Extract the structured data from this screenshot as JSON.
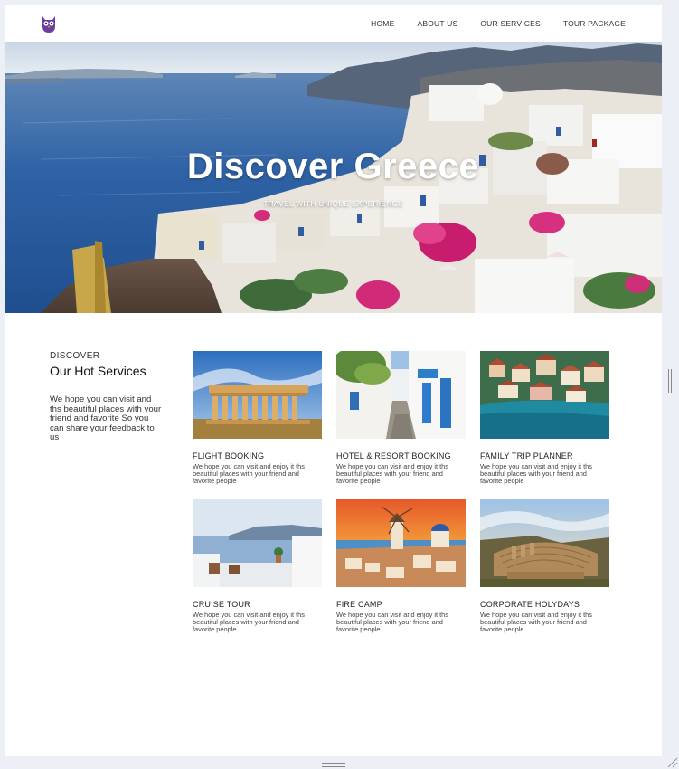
{
  "nav": {
    "logo_icon": "owl-logo-icon",
    "items": [
      {
        "label": "HOME"
      },
      {
        "label": "ABOUT US"
      },
      {
        "label": "OUR SERVICES"
      },
      {
        "label": "TOUR PACKAGE"
      }
    ]
  },
  "hero": {
    "title": "Discover Greece",
    "subtitle": "TRAVEL WITH UNIQUE EXPERIENCE"
  },
  "intro": {
    "kicker": "DISCOVER",
    "heading": "Our Hot Services",
    "text": "We hope you can visit and ths beautiful places with your friend and favorite So you can share your feedback to us"
  },
  "services": [
    {
      "title": "FLIGHT BOOKING",
      "text": "We hope you can visit and enjoy it ths beautiful places with your friend and favorite people",
      "image": "parthenon-photo"
    },
    {
      "title": "HOTEL & RESORT BOOKING",
      "text": "We hope you can visit and enjoy it ths beautiful places with your friend and favorite people",
      "image": "white-alley-photo"
    },
    {
      "title": "FAMILY TRIP PLANNER",
      "text": "We hope you can visit and enjoy it ths beautiful places with your friend and favorite people",
      "image": "coastal-village-photo"
    },
    {
      "title": "CRUISE TOUR",
      "text": "We hope you can visit and enjoy it ths beautiful places with your friend and favorite people",
      "image": "terrace-sea-view-photo"
    },
    {
      "title": "FIRE CAMP",
      "text": "We hope you can visit and enjoy it ths beautiful places with your friend and favorite people",
      "image": "windmills-sunset-photo"
    },
    {
      "title": "CORPORATE HOLYDAYS",
      "text": "We hope you can visit and enjoy it ths beautiful places with your friend and favorite people",
      "image": "ancient-theater-photo"
    }
  ],
  "colors": {
    "logo": "#6b3fa0",
    "sea": "#2a5fa8",
    "bougainvillea": "#d6257a"
  }
}
